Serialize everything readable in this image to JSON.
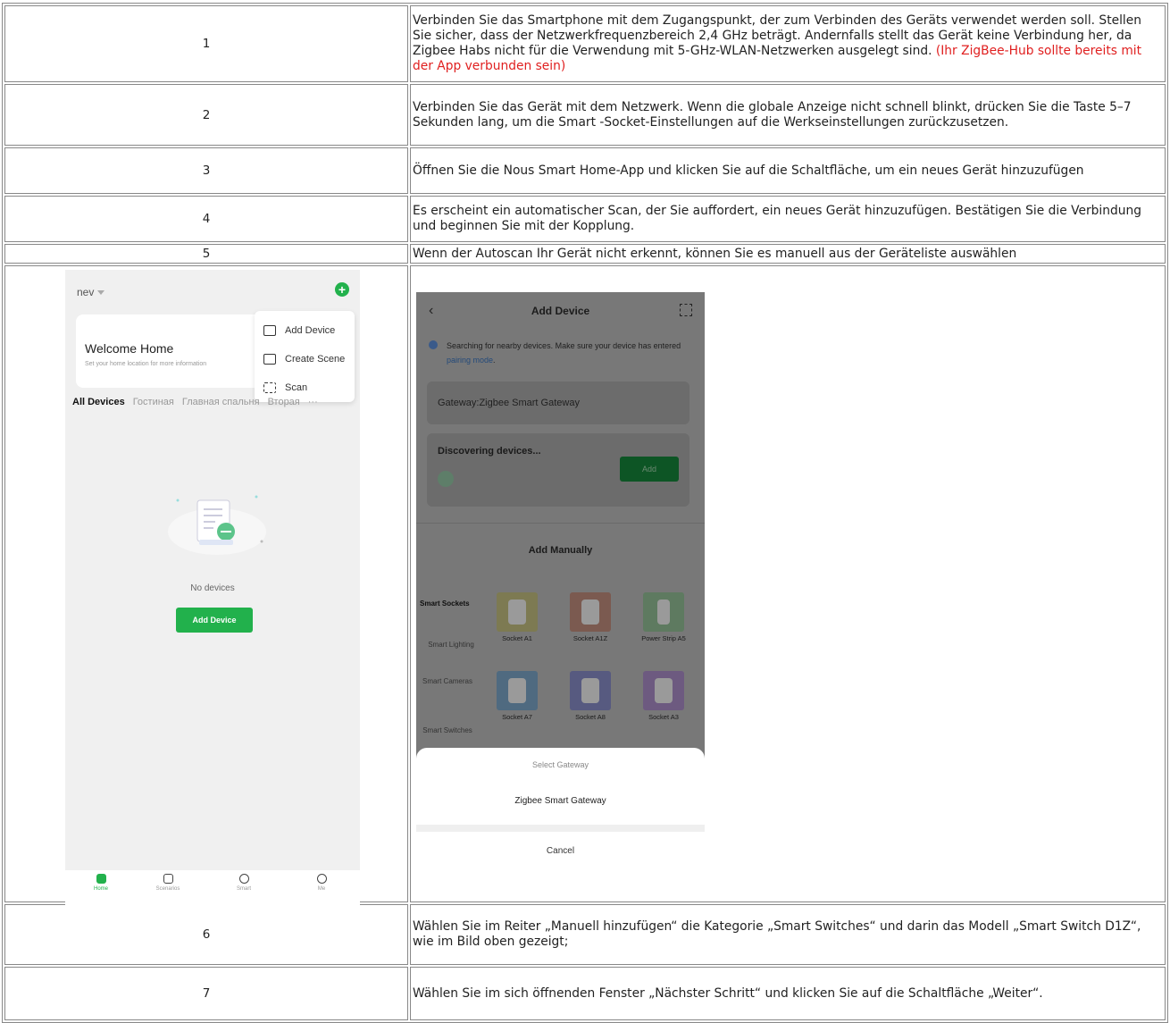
{
  "steps": [
    {
      "num": "1",
      "text": "Verbinden Sie das Smartphone mit dem Zugangspunkt, der zum Verbinden des Geräts verwendet werden soll. Stellen Sie sicher, dass der Netzwerkfrequenzbereich 2,4 GHz beträgt. Andernfalls stellt das Gerät keine Verbindung her, da Zigbee Habs nicht für die Verwendung mit 5-GHz-WLAN-Netzwerken ausgelegt sind. ",
      "note": "(Ihr ZigBee-Hub sollte bereits mit der App verbunden sein)"
    },
    {
      "num": "2",
      "text": "Verbinden Sie das Gerät mit dem Netzwerk. Wenn die globale Anzeige nicht schnell blinkt, drücken Sie die Taste 5–7 Sekunden lang, um die Smart  -Socket-Einstellungen auf die Werkseinstellungen zurückzusetzen."
    },
    {
      "num": "3",
      "text": "Öffnen Sie die Nous Smart Home-App und klicken Sie auf die Schaltfläche, um ein neues Gerät hinzuzufügen"
    },
    {
      "num": "4",
      "text": "Es erscheint ein automatischer Scan, der Sie auffordert, ein neues Gerät hinzuzufügen. Bestätigen Sie die Verbindung und beginnen Sie mit der Kopplung."
    },
    {
      "num": "5",
      "text": "Wenn der Autoscan Ihr Gerät nicht erkennt, können Sie es manuell aus der Geräteliste auswählen"
    },
    {
      "num": "6",
      "text": "Wählen Sie im Reiter „Manuell hinzufügen“ die Kategorie „Smart Switches“ und darin das Modell „Smart Switch D1Z“, wie im Bild oben gezeigt;"
    },
    {
      "num": "7",
      "text": "Wählen Sie im sich öffnenden Fenster „Nächster Schritt“ und klicken Sie auf die Schaltfläche „Weiter“."
    }
  ],
  "screen1": {
    "home_name": "nev",
    "welcome": "Welcome Home",
    "welcome_sub": "Set your home location for more information",
    "menu": [
      "Add Device",
      "Create Scene",
      "Scan"
    ],
    "tabs": [
      "All Devices",
      "Гостиная",
      "Главная спальня",
      "Вторая"
    ],
    "tabs_more": "···",
    "empty_text": "No devices",
    "add_button": "Add Device",
    "nav": [
      "Home",
      "Scenarios",
      "Smart",
      "Me"
    ],
    "accent_color": "#22b14c"
  },
  "screen2": {
    "title": "Add Device",
    "searching": "Searching for nearby devices. Make sure your device has entered ",
    "pairing_link": "pairing mode",
    "searching_end": ".",
    "gateway": "Gateway:Zigbee Smart Gateway",
    "discovering": "Discovering devices...",
    "add_button": "Add",
    "add_manually": "Add Manually",
    "categories": [
      "Smart Sockets",
      "Smart Lighting",
      "Smart Cameras",
      "Smart Switches"
    ],
    "devices": [
      "Socket A1",
      "Socket A1Z",
      "Power Strip A5",
      "Socket A7",
      "Socket A8",
      "Socket A3"
    ],
    "sheet_title": "Select Gateway",
    "sheet_option": "Zigbee Smart Gateway",
    "sheet_cancel": "Cancel"
  }
}
